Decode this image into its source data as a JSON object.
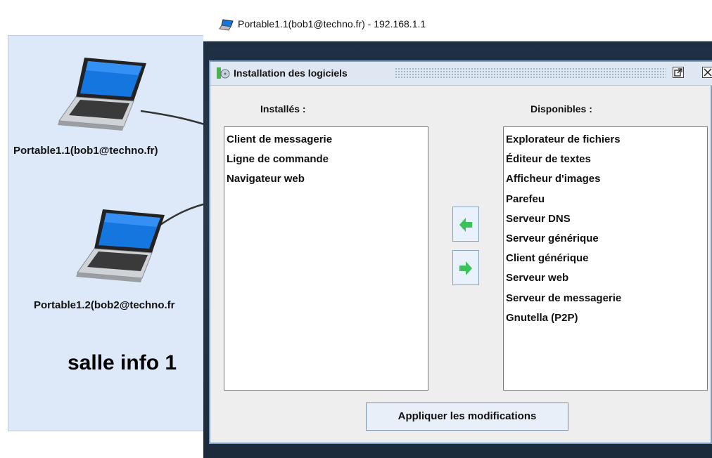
{
  "network": {
    "room_label": "salle info 1",
    "nodes": [
      {
        "label": "Portable1.1(bob1@techno.fr)",
        "icon": "laptop-icon"
      },
      {
        "label": "Portable1.2(bob2@techno.fr",
        "icon": "laptop-icon"
      }
    ]
  },
  "window": {
    "title": "Portable1.1(bob1@techno.fr) - 192.168.1.1",
    "icon": "app-icon"
  },
  "dialog": {
    "title": "Installation des logiciels",
    "installed_title": "Installés :",
    "available_title": "Disponibles :",
    "installed": [
      "Client de messagerie",
      "Ligne de commande",
      "Navigateur web"
    ],
    "available": [
      "Explorateur de fichiers",
      "Éditeur de textes",
      "Afficheur d'images",
      "Parefeu",
      "Serveur DNS",
      "Serveur générique",
      "Client générique",
      "Serveur web",
      "Serveur de messagerie",
      "Gnutella (P2P)"
    ],
    "apply_label": "Appliquer les modifications",
    "arrow_color": "#3cc25a"
  }
}
